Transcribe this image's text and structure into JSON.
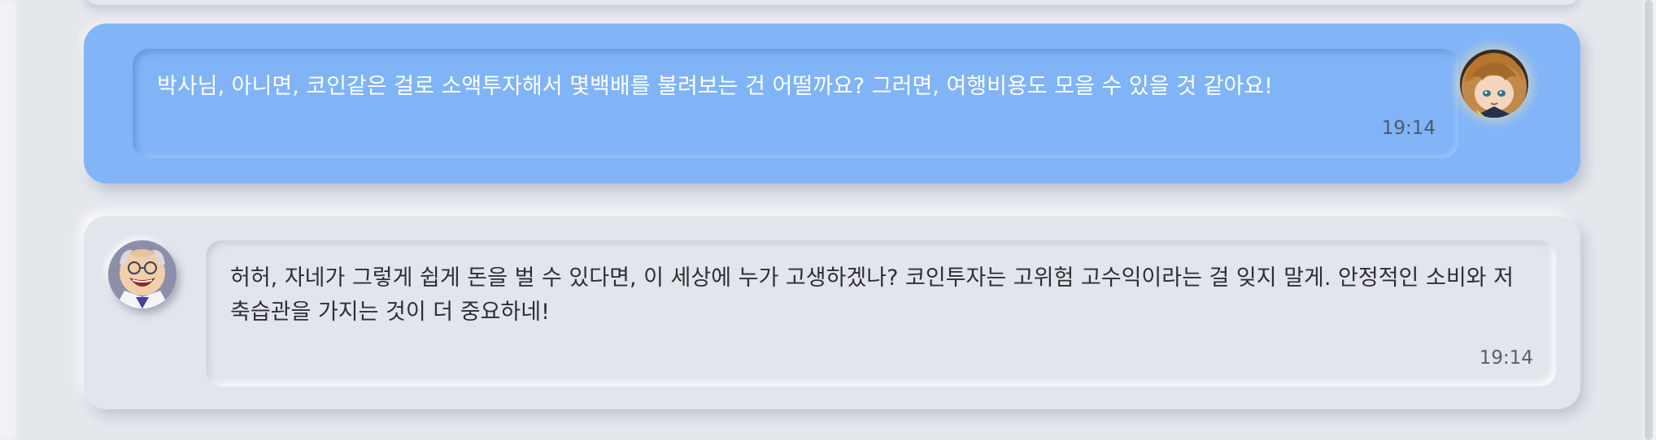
{
  "messages": [
    {
      "role": "user",
      "text": "박사님, 아니면, 코인같은 걸로 소액투자해서 몇백배를 불려보는 건 어떨까요? 그러면, 여행비용도 모을 수 있을 것 같아요!",
      "time": "19:14",
      "avatar_icon": "girl-avatar-icon"
    },
    {
      "role": "assistant",
      "text": "허허, 자네가 그렇게 쉽게 돈을 벌 수 있다면, 이 세상에 누가 고생하겠나? 코인투자는 고위험 고수익이라는 걸 잊지 말게. 안정적인 소비와 저축습관을 가지는 것이 더 중요하네!",
      "time": "19:14",
      "avatar_icon": "professor-avatar-icon"
    }
  ],
  "colors": {
    "background": "#e4e7ec",
    "user_card": "#82b5f8",
    "bot_card": "#e2e6ec",
    "user_text": "#ffffff",
    "bot_text": "#2d2f33"
  }
}
